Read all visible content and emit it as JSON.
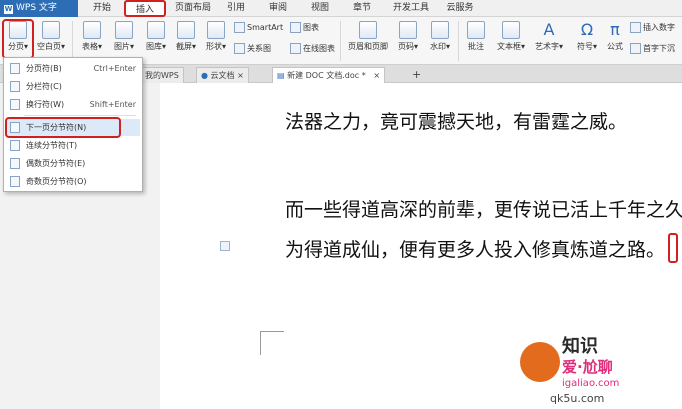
{
  "app": {
    "menu_label": "WPS 文字",
    "logo_char": "W"
  },
  "menu_tabs": [
    "开始",
    "插入",
    "页面布局",
    "引用",
    "审阅",
    "视图",
    "章节",
    "开发工具",
    "云服务"
  ],
  "ribbon": {
    "fenye": "分页",
    "blank_page": "空白页",
    "table": "表格",
    "picture": "图片",
    "gallery": "图库",
    "screenshot": "截屏",
    "shape": "形状",
    "smartart": "SmartArt",
    "chart": "图表",
    "relation_map": "关系图",
    "online_chart": "在线图表",
    "header_footer": "页眉和页脚",
    "page_number": "页码",
    "watermark": "水印",
    "comment": "批注",
    "textbox": "文本框",
    "wordart": "艺术字",
    "symbol": "符号",
    "formula": "公式",
    "insert_number": "插入数字",
    "drop_cap": "首字下沉"
  },
  "doc_tabs": [
    "我的WPS",
    "云文档",
    "新建 DOC 文档.doc *"
  ],
  "dropdown": {
    "items": [
      {
        "label": "分页符(B)",
        "shortcut": "Ctrl+Enter"
      },
      {
        "label": "分栏符(C)",
        "shortcut": ""
      },
      {
        "label": "换行符(W)",
        "shortcut": "Shift+Enter"
      },
      {
        "label": "下一页分节符(N)",
        "shortcut": ""
      },
      {
        "label": "连续分节符(T)",
        "shortcut": ""
      },
      {
        "label": "偶数页分节符(E)",
        "shortcut": ""
      },
      {
        "label": "奇数页分节符(O)",
        "shortcut": ""
      }
    ]
  },
  "document": {
    "lines": [
      "法器之力，竟可震撼天地，有雷霆之威。",
      "而一些得道高深的前辈，更传说已活上千年之久",
      "为得道成仙，便有更多人投入修真炼道之路。"
    ]
  },
  "watermark": {
    "line1": "知识",
    "line2": "爱·尬聊",
    "line3": "igaliao.com",
    "line4": "qk5u.com"
  },
  "colors": {
    "accent_blue": "#2d6db5",
    "highlight_red": "#d02020"
  }
}
